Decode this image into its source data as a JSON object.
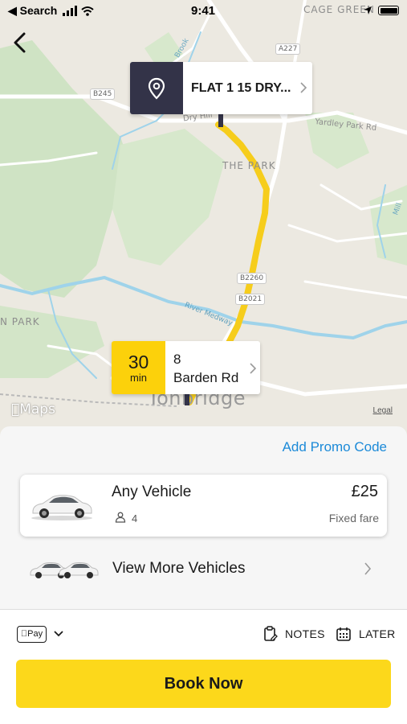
{
  "status_bar": {
    "back_app": "◀ Search",
    "time": "9:41"
  },
  "map": {
    "labels": {
      "area_cage_green": "CAGE GREEN",
      "area_the_park": "THE PARK",
      "area_n_park": "N PARK",
      "town": "Tonbridge",
      "road_dry_hill": "Dry Hill",
      "road_yardley": "Yardley Park Rd",
      "road_brook": "Brook",
      "river": "River Medway",
      "road_mill": "Mill"
    },
    "shields": {
      "a227": "A227",
      "b245": "B245",
      "b2260": "B2260",
      "b2021": "B2021"
    },
    "maps_logo": "Maps",
    "legal": "Legal",
    "pickup": {
      "label": "FLAT 1 15 DRY..."
    },
    "dropoff": {
      "eta_value": "30",
      "eta_unit": "min",
      "line1": "8",
      "line2": "Barden Rd"
    }
  },
  "sheet": {
    "promo_link": "Add Promo Code",
    "vehicle": {
      "name": "Any Vehicle",
      "passengers": "4",
      "price": "£25",
      "fare_type": "Fixed fare"
    },
    "more_vehicles": "View More Vehicles",
    "payment": {
      "method": "Pay"
    },
    "actions": {
      "notes": "NOTES",
      "later": "LATER"
    },
    "book_button": "Book Now"
  },
  "colors": {
    "accent_yellow": "#fcd81b",
    "route_yellow": "#f6cd1c",
    "pin_dark": "#333348",
    "link_blue": "#1c8ad8"
  }
}
